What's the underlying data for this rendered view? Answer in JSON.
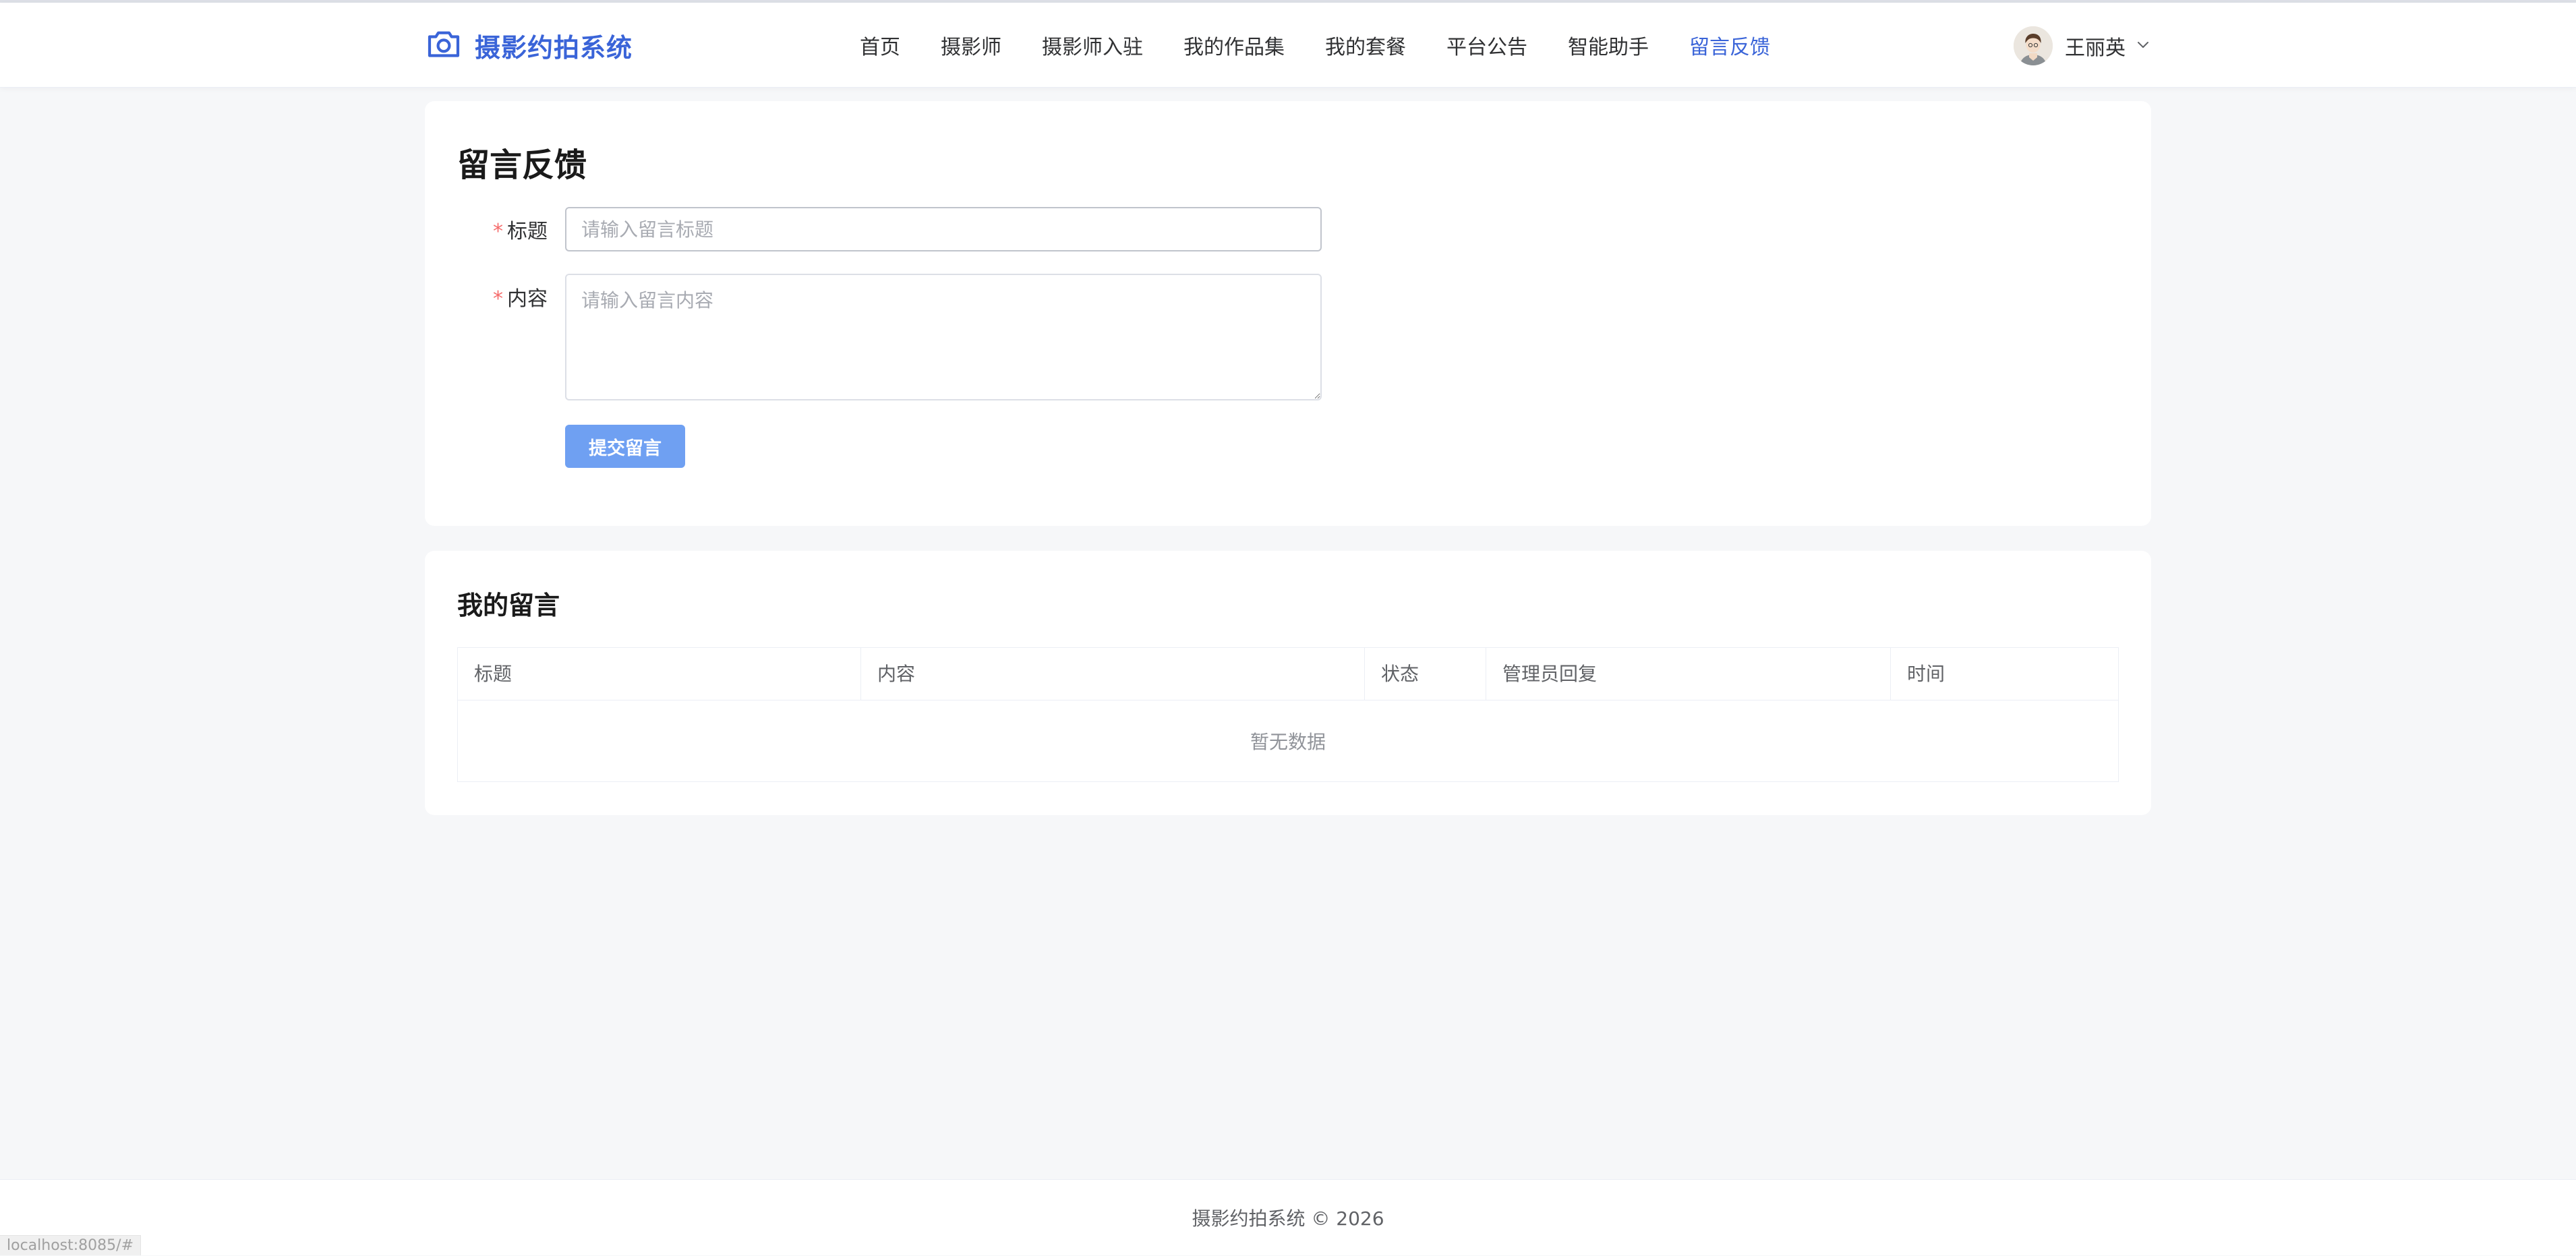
{
  "header": {
    "brand_icon": "camera-icon",
    "brand_title": "摄影约拍系统",
    "nav": [
      "首页",
      "摄影师",
      "摄影师入驻",
      "我的作品集",
      "我的套餐",
      "平台公告",
      "智能助手",
      "留言反馈"
    ],
    "active_nav": "留言反馈",
    "user_name": "王丽英"
  },
  "feedback_form": {
    "title": "留言反馈",
    "title_label": "标题",
    "title_placeholder": "请输入留言标题",
    "title_value": "",
    "content_label": "内容",
    "content_placeholder": "请输入留言内容",
    "content_value": "",
    "submit_label": "提交留言"
  },
  "my_messages": {
    "title": "我的留言",
    "columns": [
      "标题",
      "内容",
      "状态",
      "管理员回复",
      "时间"
    ],
    "rows": [],
    "empty_text": "暂无数据"
  },
  "footer": {
    "text": "摄影约拍系统 © 2026"
  },
  "status_bar": {
    "url": "localhost:8085/#"
  },
  "colors": {
    "brand": "#3a64d8",
    "primary_button": "#6fa0f2",
    "required": "#f56c6c"
  }
}
